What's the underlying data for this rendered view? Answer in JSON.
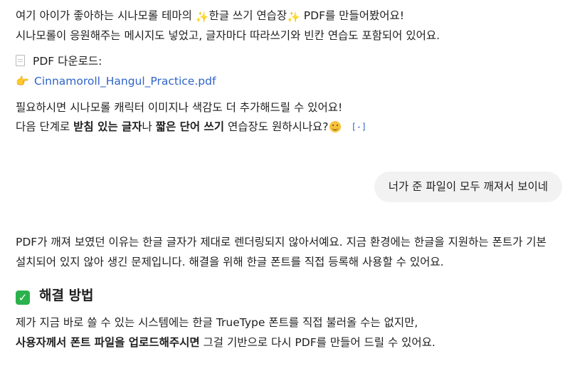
{
  "assistant_message_1": {
    "line1_pre": "여기 아이가 좋아하는 시나모롤 테마의 ",
    "sparkle_glyph": "✨",
    "line1_mid": "한글 쓰기 연습장",
    "line1_post": " PDF를 만들어봤어요!",
    "line2": "시나모롤이 응원해주는 메시지도 넣었고, 글자마다 따라쓰기와 빈칸 연습도 포함되어 있어요.",
    "download_label": "PDF 다운로드:",
    "point_glyph": "👉",
    "file_link": "Cinnamoroll_Hangul_Practice.pdf",
    "line5": "필요하시면 시나모롤 캐릭터 이미지나 색감도 더 추가해드릴 수 있어요!",
    "line6_a": "다음 단계로 ",
    "line6_b": "받침 있는 글자",
    "line6_c": "나 ",
    "line6_d": "짧은 단어 쓰기",
    "line6_e": " 연습장도 원하시나요?",
    "source_glyph": "[-]"
  },
  "user_message": {
    "text": "너가 준 파일이 모두 깨져서 보이네"
  },
  "assistant_message_2": {
    "para1": "PDF가 깨져 보였던 이유는 한글 글자가 제대로 렌더링되지 않아서예요. 지금 환경에는 한글을 지원하는 폰트가 기본 설치되어 있지 않아 생긴 문제입니다. 해결을 위해 한글 폰트를 직접 등록해 사용할 수 있어요.",
    "check_glyph": "✓",
    "heading": "해결 방법",
    "para2_line1": "제가 지금 바로 쓸 수 있는 시스템에는 한글 TrueType 폰트를 직접 불러올 수는 없지만,",
    "para2_line2_bold": "사용자께서 폰트 파일을 업로드해주시면",
    "para2_line2_rest": " 그걸 기반으로 다시 PDF를 만들어 드릴 수 있어요."
  },
  "colors": {
    "link": "#2f64c8",
    "bubble_bg": "#f2f2f2",
    "check_bg": "#2bb24c"
  }
}
